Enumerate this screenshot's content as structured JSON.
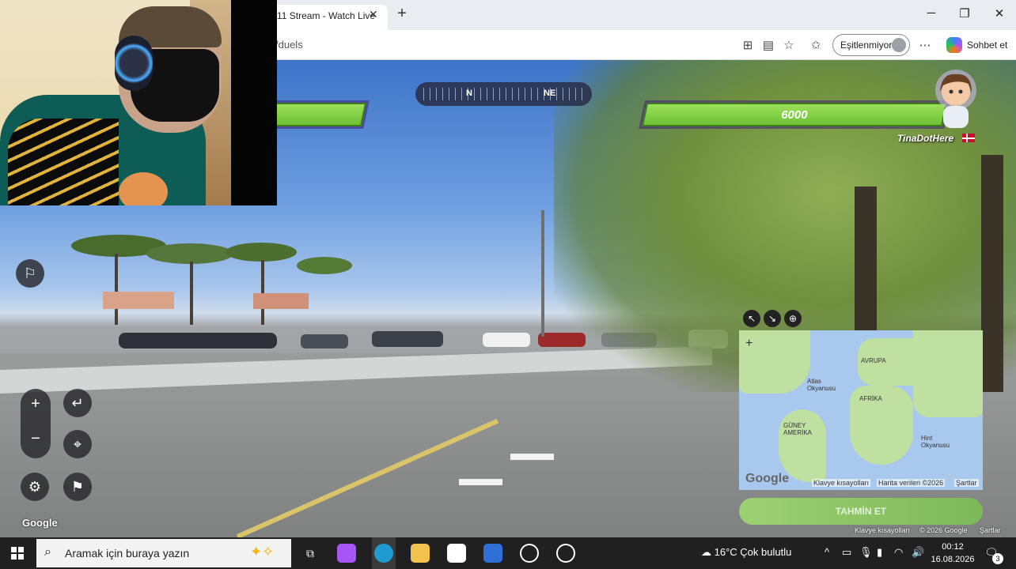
{
  "browser": {
    "tab_title": "11 Stream - Watch Live",
    "tab_close_icon": "close-icon",
    "new_tab_icon": "plus-icon",
    "url": "/duels",
    "sync_label": "Eşitlenmiyor",
    "copilot_label": "Sohbet et",
    "window_controls": [
      "minimize-icon",
      "restore-icon",
      "close-icon"
    ]
  },
  "game": {
    "compass_labels": [
      "N",
      "NE"
    ],
    "opponent_health": "6000",
    "opponent_name": "TinaDotHere",
    "guess_button": "TAHMİN ET",
    "streetview_brand": "Google",
    "streetview_footer": [
      "Klavye kısayolları",
      "© 2026 Google",
      "Şartlar"
    ]
  },
  "minimap": {
    "brand": "Google",
    "labels": {
      "atlantic": "Atlas Okyanusu",
      "europe": "AVRUPA",
      "africa": "AFRİKA",
      "south_america": "GÜNEY AMERİKA",
      "indian": "Hint Okyanusu"
    },
    "footer": [
      "Klavye kısayolları",
      "Harita verileri ©2026",
      "Şartlar"
    ]
  },
  "taskbar": {
    "search_placeholder": "Aramak için buraya yazın",
    "weather": "16°C  Çok bulutlu",
    "time": "00:12",
    "date": "16.08.2026",
    "notification_count": "3",
    "accent": "#202020"
  }
}
